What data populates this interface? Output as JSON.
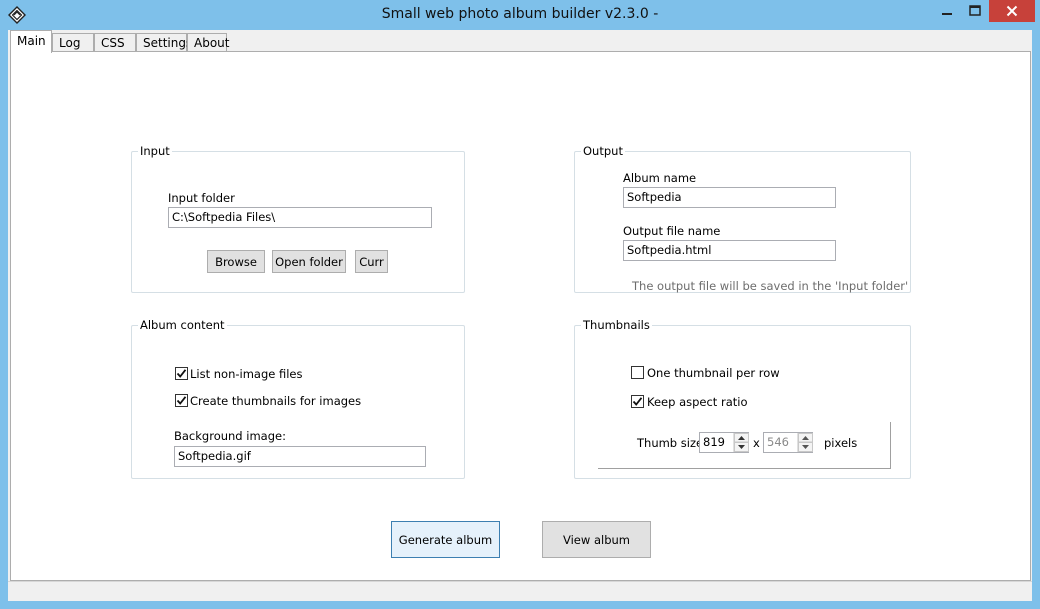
{
  "window": {
    "title": "Small web photo album builder v2.3.0 -",
    "minimize_icon": "minimize-icon",
    "maximize_icon": "maximize-icon",
    "close_icon": "close-icon",
    "app_icon": "app-diamond-icon",
    "close_color": "#c7413a",
    "frame_color": "#7ec0ea"
  },
  "tabs": [
    {
      "label": "Main",
      "active": true
    },
    {
      "label": "Log",
      "active": false
    },
    {
      "label": "CSS",
      "active": false
    },
    {
      "label": "Settings",
      "active": false
    },
    {
      "label": "About",
      "active": false
    }
  ],
  "input_group": {
    "title": "Input",
    "folder_label": "Input folder",
    "folder_value": "C:\\Softpedia Files\\",
    "browse_label": "Browse",
    "open_folder_label": "Open folder",
    "curr_label": "Curr"
  },
  "output_group": {
    "title": "Output",
    "album_name_label": "Album name",
    "album_name_value": "Softpedia",
    "output_file_label": "Output file name",
    "output_file_value": "Softpedia.html",
    "note": "The output file will be saved in the 'Input folder'"
  },
  "album_content": {
    "title": "Album content",
    "list_nonimage_label": "List non-image files",
    "list_nonimage_checked": true,
    "create_thumbs_label": "Create thumbnails for images",
    "create_thumbs_checked": true,
    "bg_image_label": "Background image:",
    "bg_image_value": "Softpedia.gif"
  },
  "thumbnails": {
    "title": "Thumbnails",
    "one_per_row_label": "One thumbnail per row",
    "one_per_row_checked": false,
    "keep_aspect_label": "Keep aspect ratio",
    "keep_aspect_checked": true,
    "thumb_size_label": "Thumb size:",
    "width_value": "819",
    "x_label": "x",
    "height_value": "546",
    "pixels_label": "pixels"
  },
  "actions": {
    "generate_label": "Generate album",
    "view_label": "View album"
  }
}
